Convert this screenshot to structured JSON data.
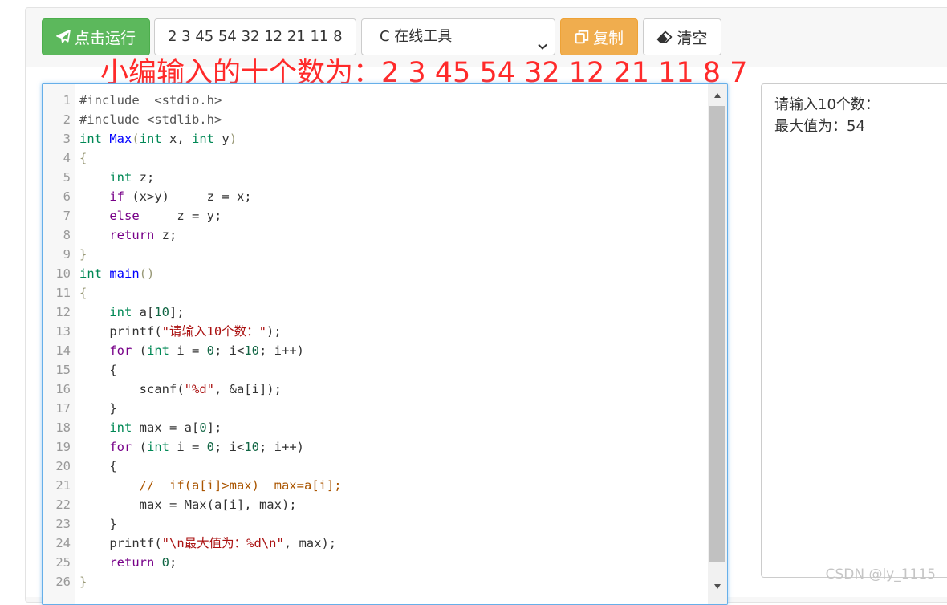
{
  "toolbar": {
    "run_label": "点击运行",
    "input_value": "2 3 45 54 32 12 21 11 8",
    "language_selected": "C 在线工具",
    "copy_label": "复制",
    "clear_label": "清空",
    "run_color": "#5cb85c",
    "copy_color": "#f0ad4e"
  },
  "annotation": "小编输入的十个数为：2 3 45 54 32 12 21 11 8 7",
  "editor": {
    "line_numbers": [
      "1",
      "2",
      "3",
      "4",
      "5",
      "6",
      "7",
      "8",
      "9",
      "10",
      "11",
      "12",
      "13",
      "14",
      "15",
      "16",
      "17",
      "18",
      "19",
      "20",
      "21",
      "22",
      "23",
      "24",
      "25",
      "26"
    ],
    "lines": [
      [
        [
          "meta",
          "#include  <stdio.h>"
        ]
      ],
      [
        [
          "meta",
          "#include <stdlib.h>"
        ]
      ],
      [
        [
          "type",
          "int"
        ],
        [
          "plain",
          " "
        ],
        [
          "def",
          "Max"
        ],
        [
          "br",
          "("
        ],
        [
          "type",
          "int"
        ],
        [
          "plain",
          " x, "
        ],
        [
          "type",
          "int"
        ],
        [
          "plain",
          " y"
        ],
        [
          "br",
          ")"
        ]
      ],
      [
        [
          "br",
          "{"
        ]
      ],
      [
        [
          "plain",
          "    "
        ],
        [
          "type",
          "int"
        ],
        [
          "plain",
          " z;"
        ]
      ],
      [
        [
          "plain",
          "    "
        ],
        [
          "kw",
          "if"
        ],
        [
          "plain",
          " (x>y)     z = x;"
        ]
      ],
      [
        [
          "plain",
          "    "
        ],
        [
          "kw",
          "else"
        ],
        [
          "plain",
          "     z = y;"
        ]
      ],
      [
        [
          "plain",
          "    "
        ],
        [
          "kw",
          "return"
        ],
        [
          "plain",
          " z;"
        ]
      ],
      [
        [
          "br",
          "}"
        ]
      ],
      [
        [
          "type",
          "int"
        ],
        [
          "plain",
          " "
        ],
        [
          "def",
          "main"
        ],
        [
          "br",
          "()"
        ]
      ],
      [
        [
          "br",
          "{"
        ]
      ],
      [
        [
          "plain",
          "    "
        ],
        [
          "type",
          "int"
        ],
        [
          "plain",
          " a["
        ],
        [
          "num",
          "10"
        ],
        [
          "plain",
          "];"
        ]
      ],
      [
        [
          "plain",
          "    printf("
        ],
        [
          "str",
          "\"请输入10个数：\""
        ],
        [
          "plain",
          ");"
        ]
      ],
      [
        [
          "plain",
          "    "
        ],
        [
          "kw",
          "for"
        ],
        [
          "plain",
          " ("
        ],
        [
          "type",
          "int"
        ],
        [
          "plain",
          " i = "
        ],
        [
          "num",
          "0"
        ],
        [
          "plain",
          "; i<"
        ],
        [
          "num",
          "10"
        ],
        [
          "plain",
          "; i++)"
        ]
      ],
      [
        [
          "plain",
          "    {"
        ]
      ],
      [
        [
          "plain",
          "        scanf("
        ],
        [
          "str",
          "\"%d\""
        ],
        [
          "plain",
          ", &a[i]);"
        ]
      ],
      [
        [
          "plain",
          "    }"
        ]
      ],
      [
        [
          "plain",
          "    "
        ],
        [
          "type",
          "int"
        ],
        [
          "plain",
          " max = a["
        ],
        [
          "num",
          "0"
        ],
        [
          "plain",
          "];"
        ]
      ],
      [
        [
          "plain",
          "    "
        ],
        [
          "kw",
          "for"
        ],
        [
          "plain",
          " ("
        ],
        [
          "type",
          "int"
        ],
        [
          "plain",
          " i = "
        ],
        [
          "num",
          "0"
        ],
        [
          "plain",
          "; i<"
        ],
        [
          "num",
          "10"
        ],
        [
          "plain",
          "; i++)"
        ]
      ],
      [
        [
          "plain",
          "    {"
        ]
      ],
      [
        [
          "plain",
          "        "
        ],
        [
          "cmt",
          "//  if(a[i]>max)  max=a[i];"
        ]
      ],
      [
        [
          "plain",
          "        max = Max(a[i], max);"
        ]
      ],
      [
        [
          "plain",
          "    }"
        ]
      ],
      [
        [
          "plain",
          "    printf("
        ],
        [
          "str",
          "\"\\n最大值为：%d\\n\""
        ],
        [
          "plain",
          ", max);"
        ]
      ],
      [
        [
          "plain",
          "    "
        ],
        [
          "kw",
          "return"
        ],
        [
          "plain",
          " "
        ],
        [
          "num",
          "0"
        ],
        [
          "plain",
          ";"
        ]
      ],
      [
        [
          "br",
          "}"
        ]
      ]
    ]
  },
  "output": {
    "lines": [
      "请输入10个数：",
      "最大值为：54"
    ]
  },
  "watermark": "CSDN @ly_1115"
}
